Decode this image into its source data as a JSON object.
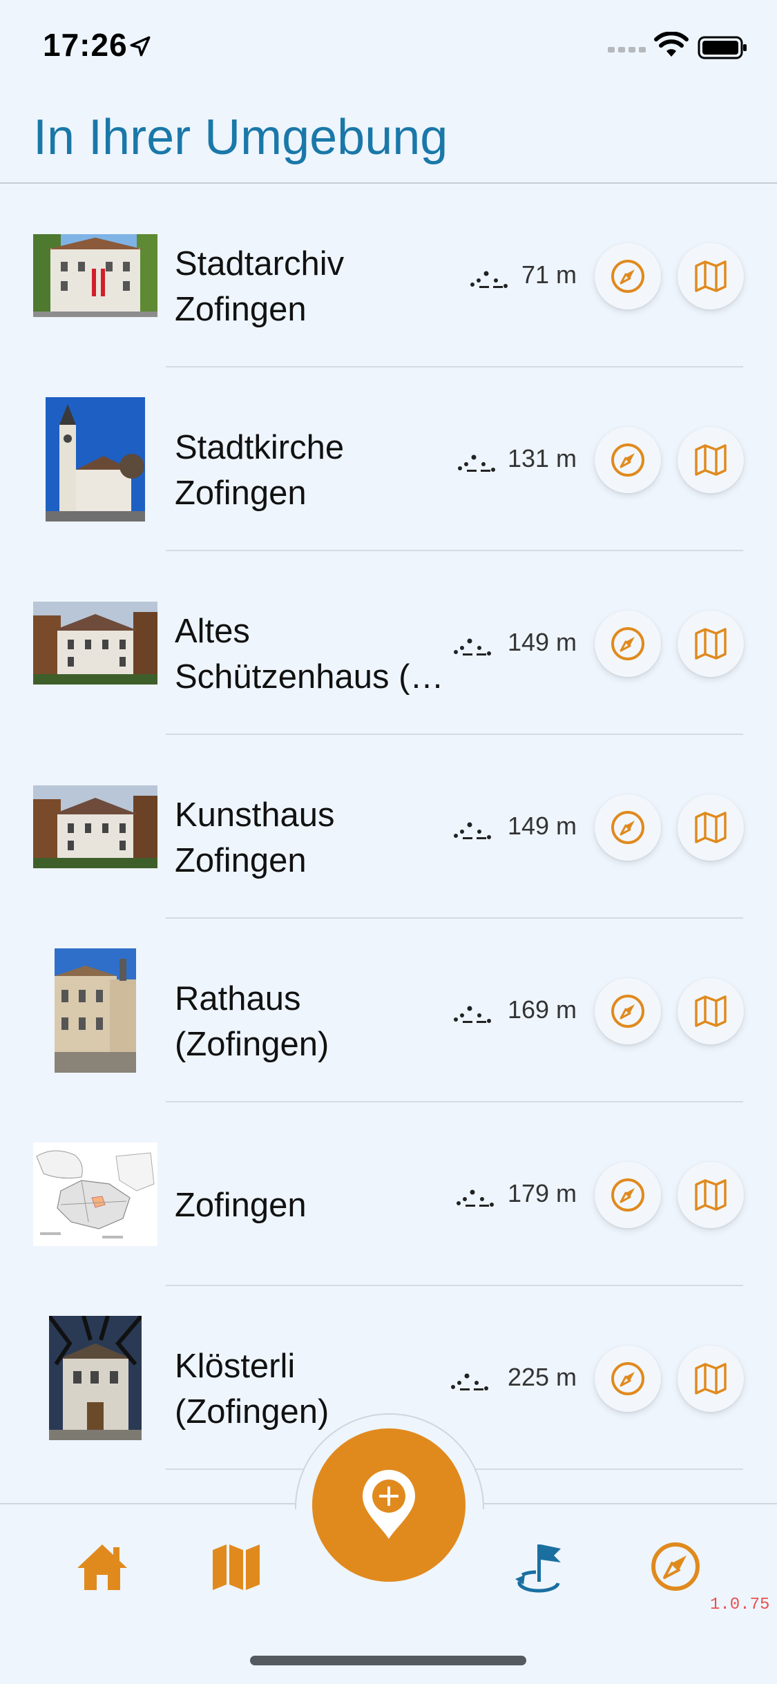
{
  "status_bar": {
    "time": "17:26",
    "icons": [
      "location-arrow-icon",
      "cellular-signal-icon",
      "wifi-icon",
      "battery-icon"
    ]
  },
  "header": {
    "title": "In Ihrer Umgebung"
  },
  "colors": {
    "accent": "#e08a1e",
    "title": "#1a78a8",
    "background": "#eef5fd",
    "tab_active": "#1a6fa0",
    "version": "#e85050"
  },
  "places": [
    {
      "name_line1": "Stadtarchiv",
      "name_line2": "Zofingen",
      "distance": "71 m"
    },
    {
      "name_line1": "Stadtkirche",
      "name_line2": "Zofingen",
      "distance": "131 m"
    },
    {
      "name_line1": "Altes",
      "name_line2": "Schützenhaus (…",
      "distance": "149 m"
    },
    {
      "name_line1": "Kunsthaus",
      "name_line2": "Zofingen",
      "distance": "149 m"
    },
    {
      "name_line1": "Rathaus",
      "name_line2": "(Zofingen)",
      "distance": "169 m"
    },
    {
      "name_line1": "Zofingen",
      "name_line2": "",
      "distance": "179 m"
    },
    {
      "name_line1": "Klösterli",
      "name_line2": "(Zofingen)",
      "distance": "225 m"
    }
  ],
  "tab_bar": {
    "items": [
      "home-icon",
      "map-icon",
      "add-location-icon",
      "tour-flag-icon",
      "compass-icon"
    ]
  },
  "version": "1.0.75"
}
